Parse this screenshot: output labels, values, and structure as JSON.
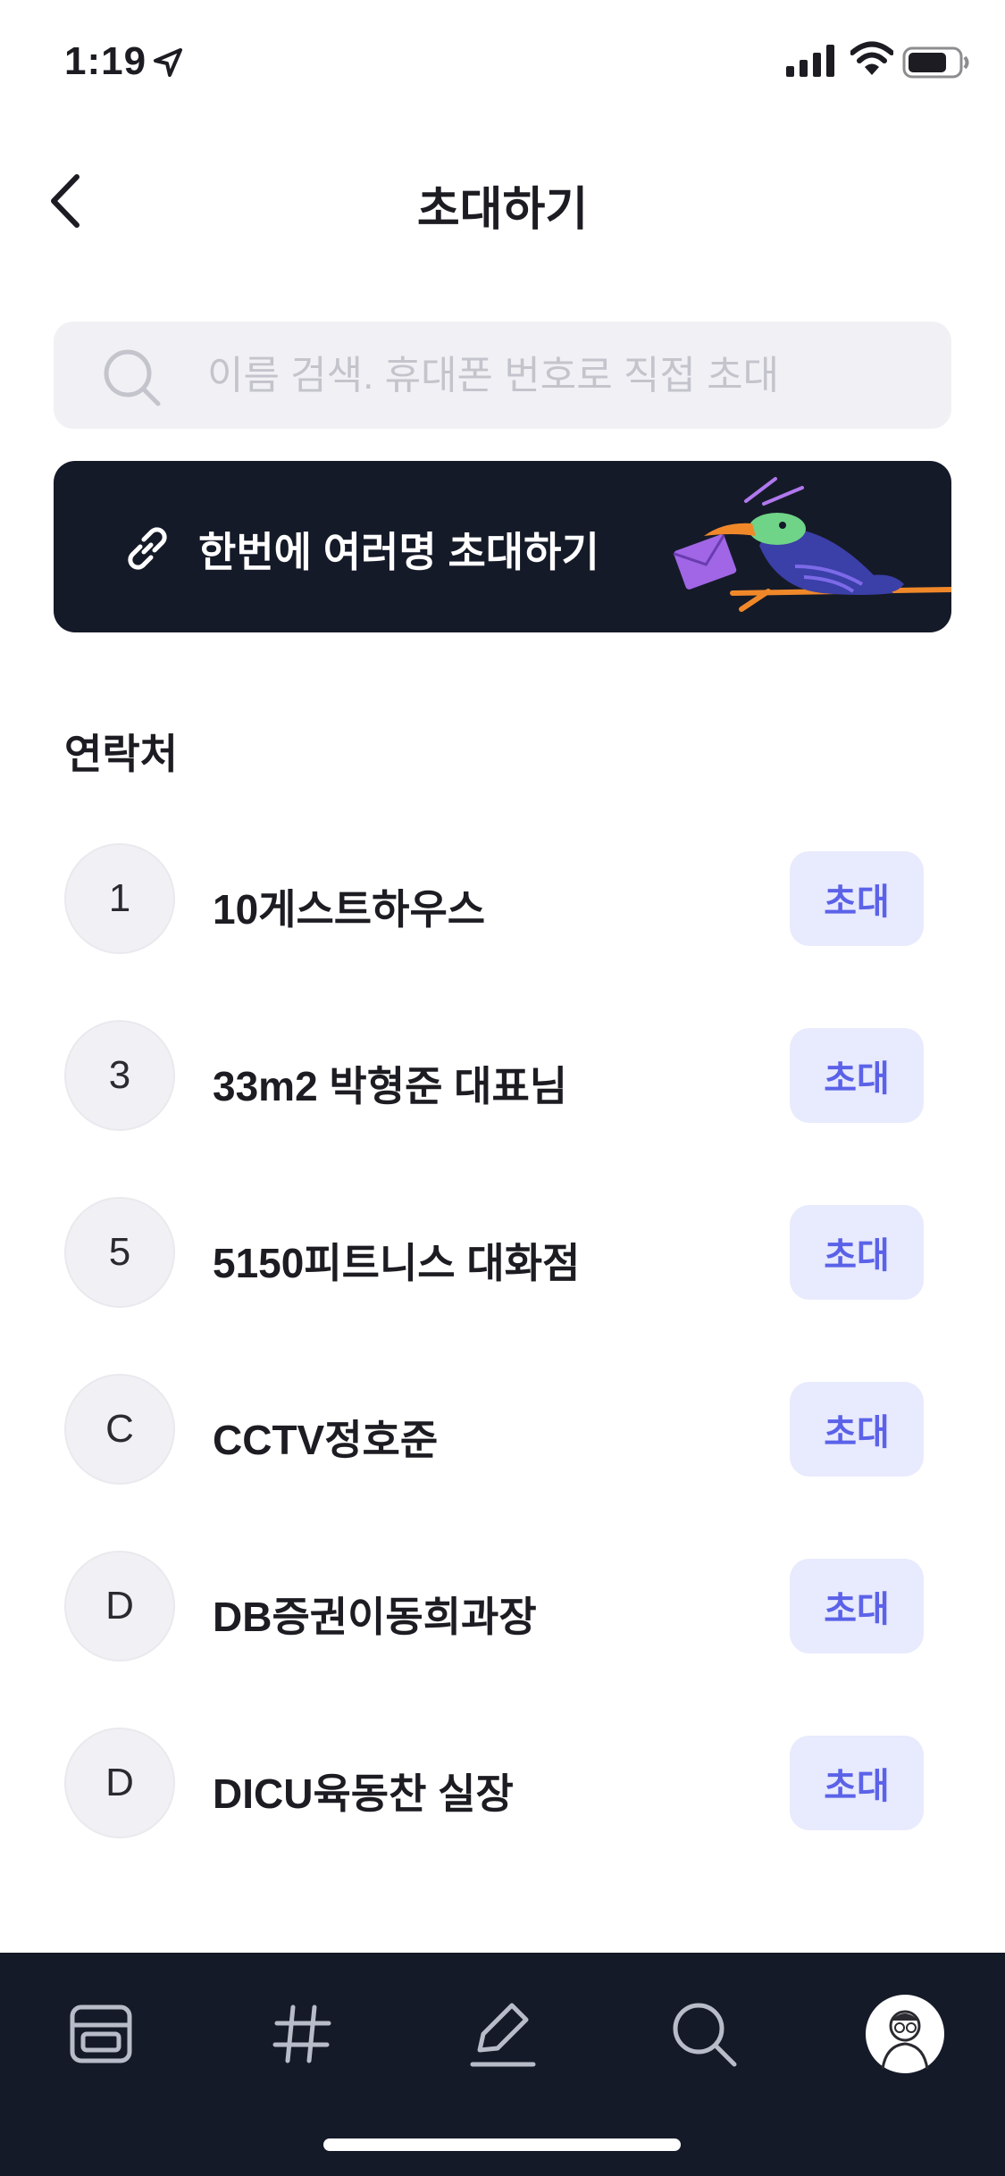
{
  "status_bar": {
    "time": "1:19"
  },
  "header": {
    "title": "초대하기"
  },
  "search": {
    "placeholder": "이름 검색. 휴대폰 번호로 직접 초대"
  },
  "banner": {
    "label": "한번에 여러명 초대하기"
  },
  "contacts_section": {
    "title": "연락처"
  },
  "contacts": [
    {
      "initial": "1",
      "name": "10게스트하우스",
      "action": "초대"
    },
    {
      "initial": "3",
      "name": "33m2 박형준 대표님",
      "action": "초대"
    },
    {
      "initial": "5",
      "name": "5150피트니스 대화점",
      "action": "초대"
    },
    {
      "initial": "C",
      "name": "CCTV정호준",
      "action": "초대"
    },
    {
      "initial": "D",
      "name": "DB증권이동희과장",
      "action": "초대"
    },
    {
      "initial": "D",
      "name": "DICU육동찬 실장",
      "action": "초대"
    }
  ],
  "tabbar": {
    "icons": [
      "feed-icon",
      "hashtag-icon",
      "write-icon",
      "search-icon",
      "profile-avatar"
    ]
  },
  "colors": {
    "dark": "#151a28",
    "accent": "#5b62e8",
    "invite_bg": "#e8eafd"
  }
}
